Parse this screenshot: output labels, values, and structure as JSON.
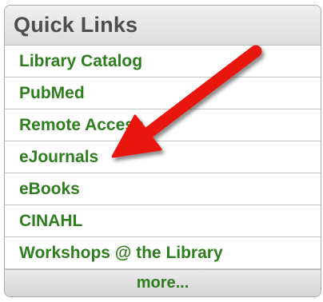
{
  "widget": {
    "title": "Quick Links",
    "links": [
      {
        "label": "Library Catalog"
      },
      {
        "label": "PubMed"
      },
      {
        "label": "Remote Access"
      },
      {
        "label": "eJournals"
      },
      {
        "label": "eBooks"
      },
      {
        "label": "CINAHL"
      },
      {
        "label": "Workshops @ the Library"
      }
    ],
    "more_label": "more..."
  },
  "annotation": {
    "icon": "red-arrow-icon",
    "color": "#e8120c"
  },
  "colors": {
    "link": "#2e7d1e",
    "header_text": "#4d4d4d"
  }
}
